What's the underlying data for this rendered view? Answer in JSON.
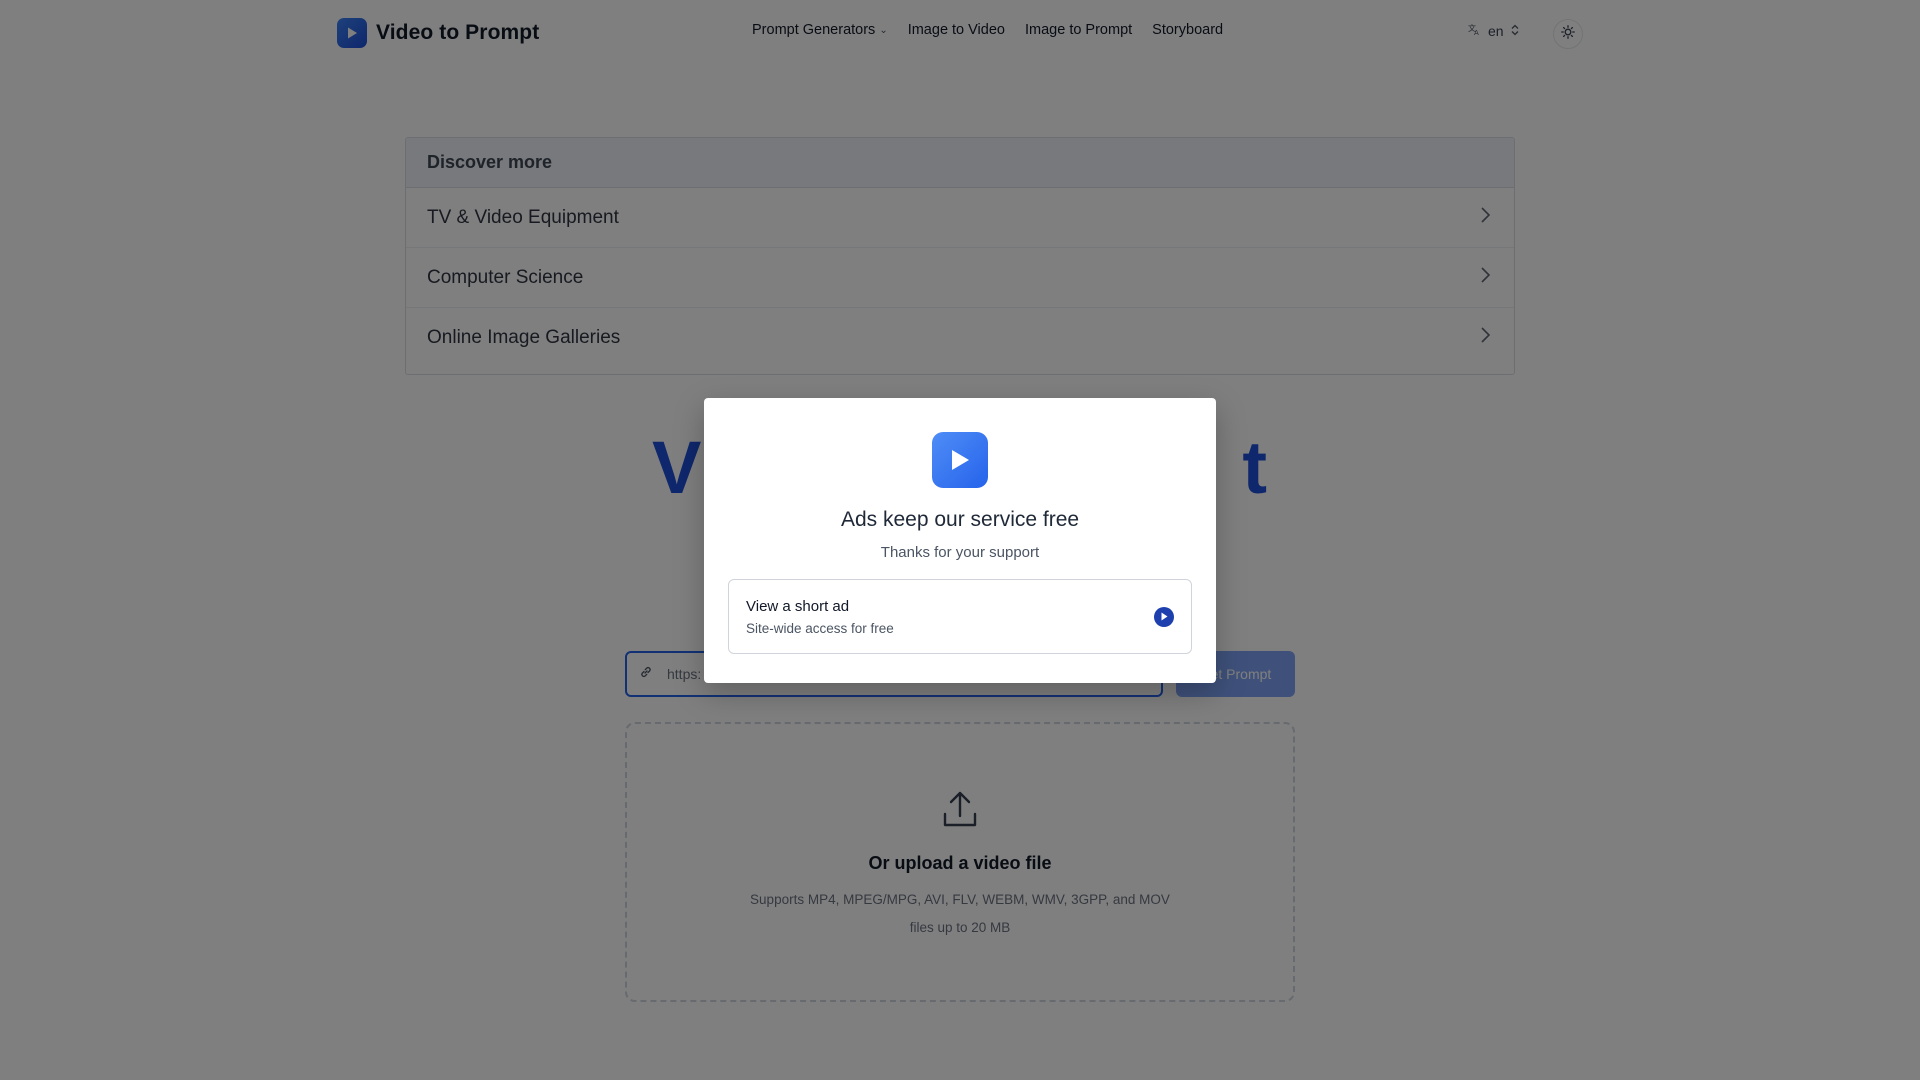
{
  "header": {
    "brand_name": "Video to Prompt",
    "nav": [
      {
        "label": "Prompt Generators",
        "has_dropdown": true
      },
      {
        "label": "Image to Video"
      },
      {
        "label": "Image to Prompt"
      },
      {
        "label": "Storyboard"
      }
    ],
    "language": "en",
    "theme_icon": "sun-icon"
  },
  "discover": {
    "title": "Discover more",
    "items": [
      {
        "label": "TV & Video Equipment"
      },
      {
        "label": "Computer Science"
      },
      {
        "label": "Online Image Galleries"
      }
    ]
  },
  "hero": {
    "title_visible_start": "V",
    "title_visible_end": "t"
  },
  "url_form": {
    "value": "https:",
    "button_label": "Get Prompt"
  },
  "upload": {
    "title": "Or upload a video file",
    "description": "Supports MP4, MPEG/MPG, AVI, FLV, WEBM, WMV, 3GPP, and MOV files up to 20 MB"
  },
  "modal": {
    "title": "Ads keep our service free",
    "subtitle": "Thanks for your support",
    "option_title": "View a short ad",
    "option_desc": "Site-wide access for free"
  },
  "colors": {
    "accent": "#2563eb",
    "hero": "#1e4fd8",
    "overlay": "rgba(0,0,0,0.5)"
  }
}
